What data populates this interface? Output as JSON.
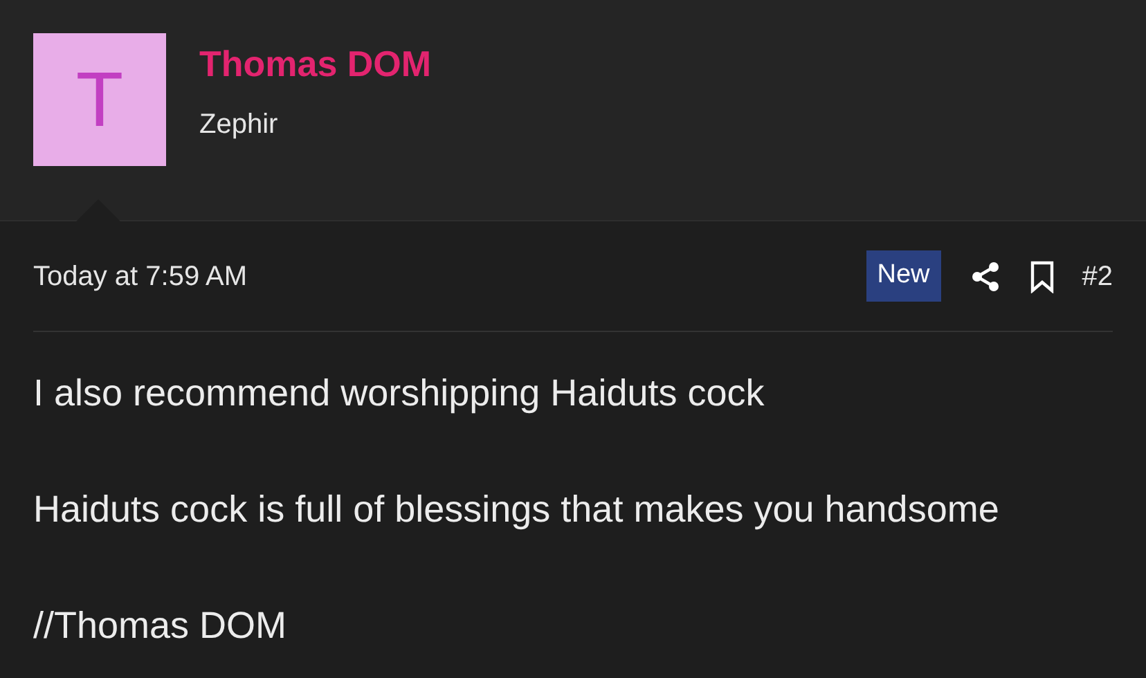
{
  "author": {
    "avatar_letter": "T",
    "name": "Thomas DOM",
    "title": "Zephir"
  },
  "post": {
    "time": "Today at 7:59 AM",
    "badge": "New",
    "number": "#2",
    "paragraphs": [
      "I also recommend worshipping Haiduts cock",
      "Haiduts cock is full of blessings that makes you handsome",
      "//Thomas DOM"
    ]
  }
}
